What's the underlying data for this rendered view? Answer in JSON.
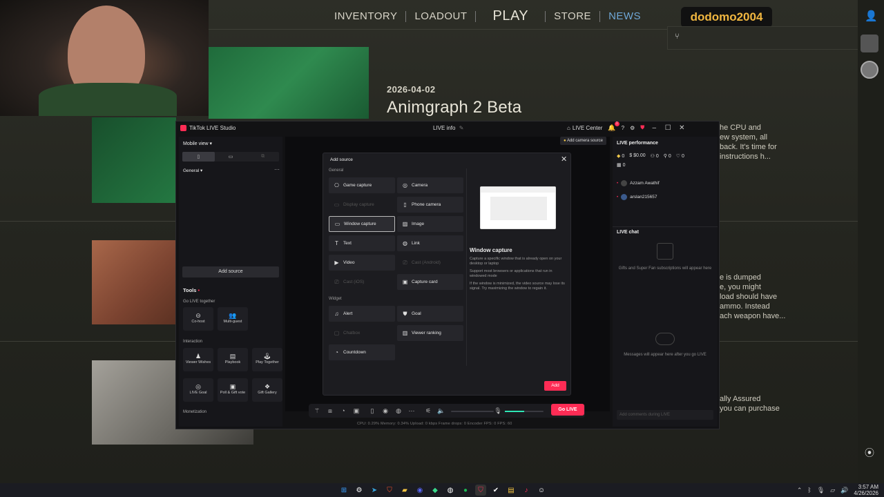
{
  "game": {
    "nav": [
      "INVENTORY",
      "LOADOUT",
      "PLAY",
      "STORE",
      "NEWS"
    ],
    "username": "dodomo2004",
    "news_date": "2026-04-02",
    "news_title": "Animgraph 2 Beta",
    "article_top": [
      "he CPU and",
      "ew system, all",
      "back. It's time for",
      "instructions h..."
    ],
    "article_mid": [
      "e is dumped",
      "e, you might",
      "load should have",
      "ammo. Instead",
      "ach weapon have..."
    ],
    "article_bot": [
      "ally Assured",
      "you can purchase"
    ],
    "accent_blue": "#6fa7d6",
    "username_color": "#f0b640"
  },
  "studio": {
    "app_title": "TikTok LIVE Studio",
    "center_title": "LIVE info",
    "live_center": "LIVE Center",
    "notif_count": "1",
    "left": {
      "view_label": "Mobile view",
      "scene_label": "General",
      "add_source": "Add source",
      "tools_title": "Tools",
      "go_live_together": "Go LIVE together",
      "interaction": "Interaction",
      "monetization": "Monetization",
      "tools_together": [
        "Co-host",
        "Multi-guest"
      ],
      "tools_interaction": [
        "Viewer Wishes",
        "Playbook",
        "Play Together",
        "LIVE Goal",
        "Poll & Gift vote",
        "Gift Gallery"
      ]
    },
    "add_camera_source": "Add camera source",
    "right": {
      "perf_title": "LIVE performance",
      "stats": [
        "0",
        "$0.00",
        "0",
        "0",
        "0",
        "0"
      ],
      "viewers": [
        "Azzam Awathif",
        "arslan215657"
      ],
      "chat_title": "LIVE chat",
      "chat_placeholder_1": "Gifts and Super Fan subscriptions will appear here",
      "chat_placeholder_2": "Messages will appear here after you go LIVE",
      "chat_input": "Add comments during LIVE"
    },
    "bottom": {
      "go_live": "Go LIVE",
      "status": "CPU: 0.29%    Memory: 0.34%    Upload: 0 kbps    Frame drops: 0    Encoder FPS: 0    FPS: 60",
      "accent": "#fe2c55",
      "volume_color": "#2ee6b6"
    }
  },
  "dialog": {
    "title": "Add source",
    "general_label": "General",
    "widget_label": "Widget",
    "general_left": [
      {
        "label": "Game capture",
        "icon": "gamepad-icon",
        "disabled": false
      },
      {
        "label": "Display capture",
        "icon": "monitor-icon",
        "disabled": true
      },
      {
        "label": "Window capture",
        "icon": "window-icon",
        "disabled": false,
        "selected": true
      },
      {
        "label": "Text",
        "icon": "text-icon",
        "disabled": false
      },
      {
        "label": "Video",
        "icon": "play-icon",
        "disabled": false
      },
      {
        "label": "Cast (iOS)",
        "icon": "cast-icon",
        "disabled": true
      }
    ],
    "general_right": [
      {
        "label": "Camera",
        "icon": "camera-icon",
        "disabled": false
      },
      {
        "label": "Phone camera",
        "icon": "phone-icon",
        "disabled": false
      },
      {
        "label": "Image",
        "icon": "image-icon",
        "disabled": false
      },
      {
        "label": "Link",
        "icon": "globe-icon",
        "disabled": false
      },
      {
        "label": "Cast (Android)",
        "icon": "cast-icon",
        "disabled": true
      },
      {
        "label": "Capture card",
        "icon": "capture-card-icon",
        "disabled": false
      }
    ],
    "widget_left": [
      {
        "label": "Alert",
        "icon": "bell-icon",
        "disabled": false
      },
      {
        "label": "Chatbox",
        "icon": "chat-icon",
        "disabled": true
      },
      {
        "label": "Countdown",
        "icon": "timer-icon",
        "disabled": false
      }
    ],
    "widget_right": [
      {
        "label": "Goal",
        "icon": "shield-icon",
        "disabled": false
      },
      {
        "label": "Viewer ranking",
        "icon": "ranking-icon",
        "disabled": false
      }
    ],
    "preview_title": "Window capture",
    "preview_desc": [
      "Capture a specific window that is already open on your desktop or laptop",
      "Support most browsers or applications that run in windowed mode",
      "If the window is minimized, the video source may lose its signal. Try maximizing the window to regain it."
    ],
    "add_label": "Add"
  },
  "taskbar": {
    "time": "3:57 AM",
    "date": "4/26/2026"
  }
}
